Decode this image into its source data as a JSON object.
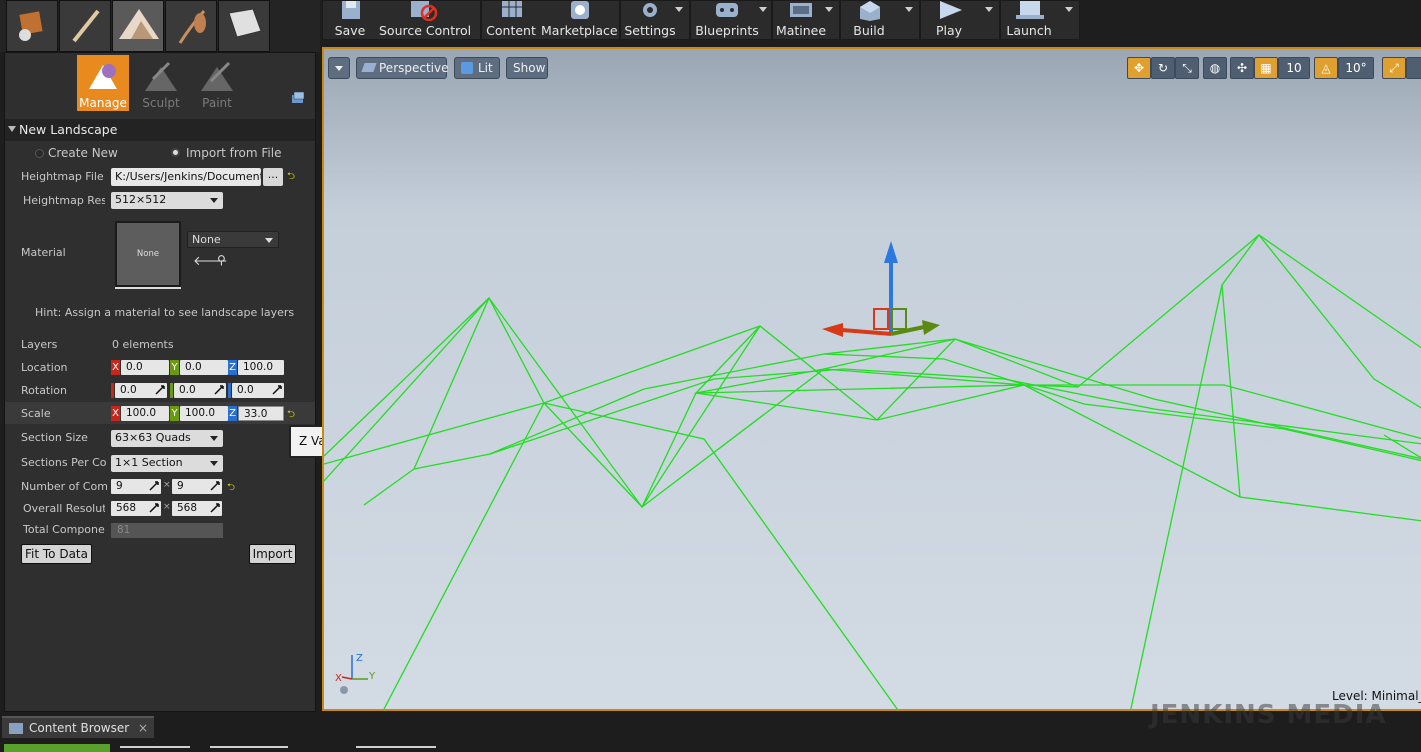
{
  "mode_tabs": [
    "place-mode-icon",
    "paint-mode-icon",
    "landscape-mode-icon",
    "foliage-mode-icon",
    "geometry-mode-icon"
  ],
  "tools": {
    "manage": "Manage",
    "sculpt": "Sculpt",
    "paint": "Paint"
  },
  "section": {
    "title": "New Landscape"
  },
  "radios": {
    "create_new": "Create New",
    "import_file": "Import from File"
  },
  "props": {
    "heightmap_file_label": "Heightmap File",
    "heightmap_file_value": "K:/Users/Jenkins/Document",
    "browse_label": "...",
    "heightmap_res_label": "Heightmap Resolution",
    "heightmap_res_value": "512×512",
    "material_label": "Material",
    "material_thumb": "None",
    "material_combo": "None",
    "hint": "Hint: Assign a material to see landscape layers",
    "layers_label": "Layers",
    "layers_value": "0 elements",
    "location_label": "Location",
    "location": {
      "x": "0.0",
      "y": "0.0",
      "z": "100.0"
    },
    "rotation_label": "Rotation",
    "rotation": {
      "x": "0.0",
      "y": "0.0",
      "z": "0.0"
    },
    "scale_label": "Scale",
    "scale": {
      "x": "100.0",
      "y": "100.0",
      "z": "33.0"
    },
    "section_size_label": "Section Size",
    "section_size_value": "63×63 Quads",
    "sections_per_label": "Sections Per Component",
    "sections_per_value": "1×1 Section",
    "num_comp_label": "Number of Components",
    "num_comp": {
      "x": "9",
      "y": "9"
    },
    "overall_res_label": "Overall Resolution",
    "overall_res": {
      "x": "568",
      "y": "568"
    },
    "total_comp_label": "Total Components",
    "total_comp_value": "81",
    "times": "×",
    "fit_button": "Fit To Data",
    "import_button": "Import"
  },
  "axes": {
    "x": "X",
    "y": "Y",
    "z": "Z"
  },
  "tooltip": "Z Value",
  "toolbar": {
    "save": "Save",
    "source_control": "Source Control",
    "content": "Content",
    "marketplace": "Marketplace",
    "settings": "Settings",
    "blueprints": "Blueprints",
    "matinee": "Matinee",
    "build": "Build",
    "play": "Play",
    "launch": "Launch"
  },
  "viewport": {
    "perspective": "Perspective",
    "lit": "Lit",
    "show": "Show",
    "grid_snap": "10",
    "rot_snap": "10°",
    "level": "Level:  Minimal_D"
  },
  "bottom": {
    "content_browser": "Content Browser",
    "close": "×"
  },
  "colors": {
    "accent_orange": "#e88a1e",
    "wireframe_green": "#22dd22",
    "sky_top": "#9ea9b5",
    "sky_bottom": "#cfd8e2"
  }
}
